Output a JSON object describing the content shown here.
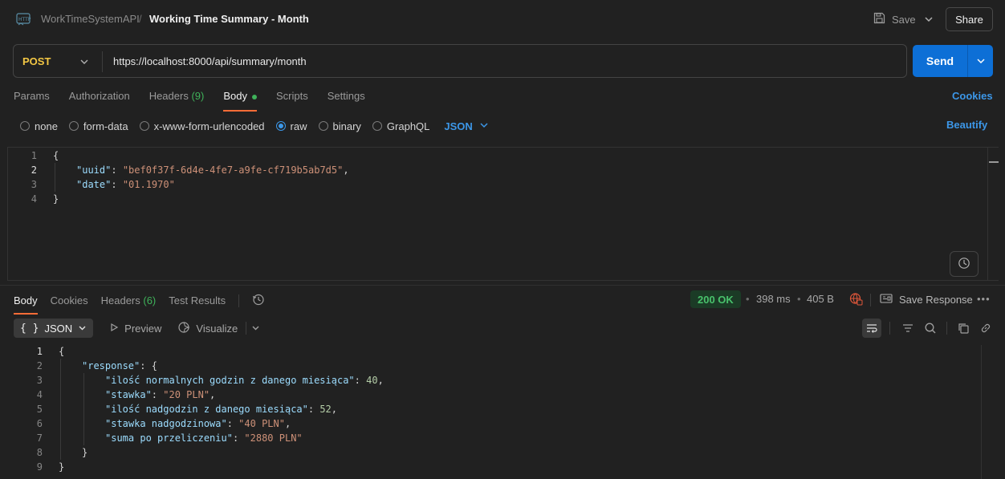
{
  "header": {
    "collection": "WorkTimeSystemAPI",
    "separator": "/",
    "request_name": "Working Time Summary - Month",
    "save_label": "Save",
    "share_label": "Share"
  },
  "request": {
    "method": "POST",
    "url": "https://localhost:8000/api/summary/month",
    "send_label": "Send"
  },
  "request_tabs": {
    "params": "Params",
    "authorization": "Authorization",
    "headers": "Headers",
    "headers_count": "(9)",
    "body": "Body",
    "scripts": "Scripts",
    "settings": "Settings",
    "cookies": "Cookies"
  },
  "body_types": {
    "none": "none",
    "form_data": "form-data",
    "urlencoded": "x-www-form-urlencoded",
    "raw": "raw",
    "binary": "binary",
    "graphql": "GraphQL",
    "language": "JSON",
    "beautify": "Beautify"
  },
  "request_body": {
    "line_numbers": [
      "1",
      "2",
      "3",
      "4"
    ],
    "uuid_key": "\"uuid\"",
    "uuid_value": "\"bef0f37f-6d4e-4fe7-a9fe-cf719b5ab7d5\"",
    "date_key": "\"date\"",
    "date_value": "\"01.1970\""
  },
  "response_tabs": {
    "body": "Body",
    "cookies": "Cookies",
    "headers": "Headers",
    "headers_count": "(6)",
    "test_results": "Test Results"
  },
  "response_meta": {
    "status": "200 OK",
    "time": "398 ms",
    "size": "405 B",
    "save_response": "Save Response"
  },
  "response_view": {
    "format": "JSON",
    "preview": "Preview",
    "visualize": "Visualize"
  },
  "response_body": {
    "line_numbers": [
      "1",
      "2",
      "3",
      "4",
      "5",
      "6",
      "7",
      "8",
      "9"
    ],
    "response_key": "\"response\"",
    "k1": "\"ilość normalnych godzin z danego miesiąca\"",
    "v1": "40",
    "k2": "\"stawka\"",
    "v2": "\"20 PLN\"",
    "k3": "\"ilość nadgodzin z danego miesiąca\"",
    "v3": "52",
    "k4": "\"stawka nadgodzinowa\"",
    "v4": "\"40 PLN\"",
    "k5": "\"suma po przeliczeniu\"",
    "v5": "\"2880 PLN\""
  },
  "colors": {
    "accent_blue": "#0d6fd6",
    "method_post": "#f3c744",
    "status_ok": "#49c26c",
    "active_tab_underline": "#ff6c37"
  },
  "icons": [
    "http-request-icon",
    "save-icon",
    "chevron-down-icon",
    "history-icon",
    "globe-icon",
    "save-response-icon",
    "more-icon",
    "preview-icon",
    "visualize-icon",
    "wrap-lines-icon",
    "filter-icon",
    "search-icon",
    "copy-icon",
    "link-icon",
    "format-icon"
  ]
}
